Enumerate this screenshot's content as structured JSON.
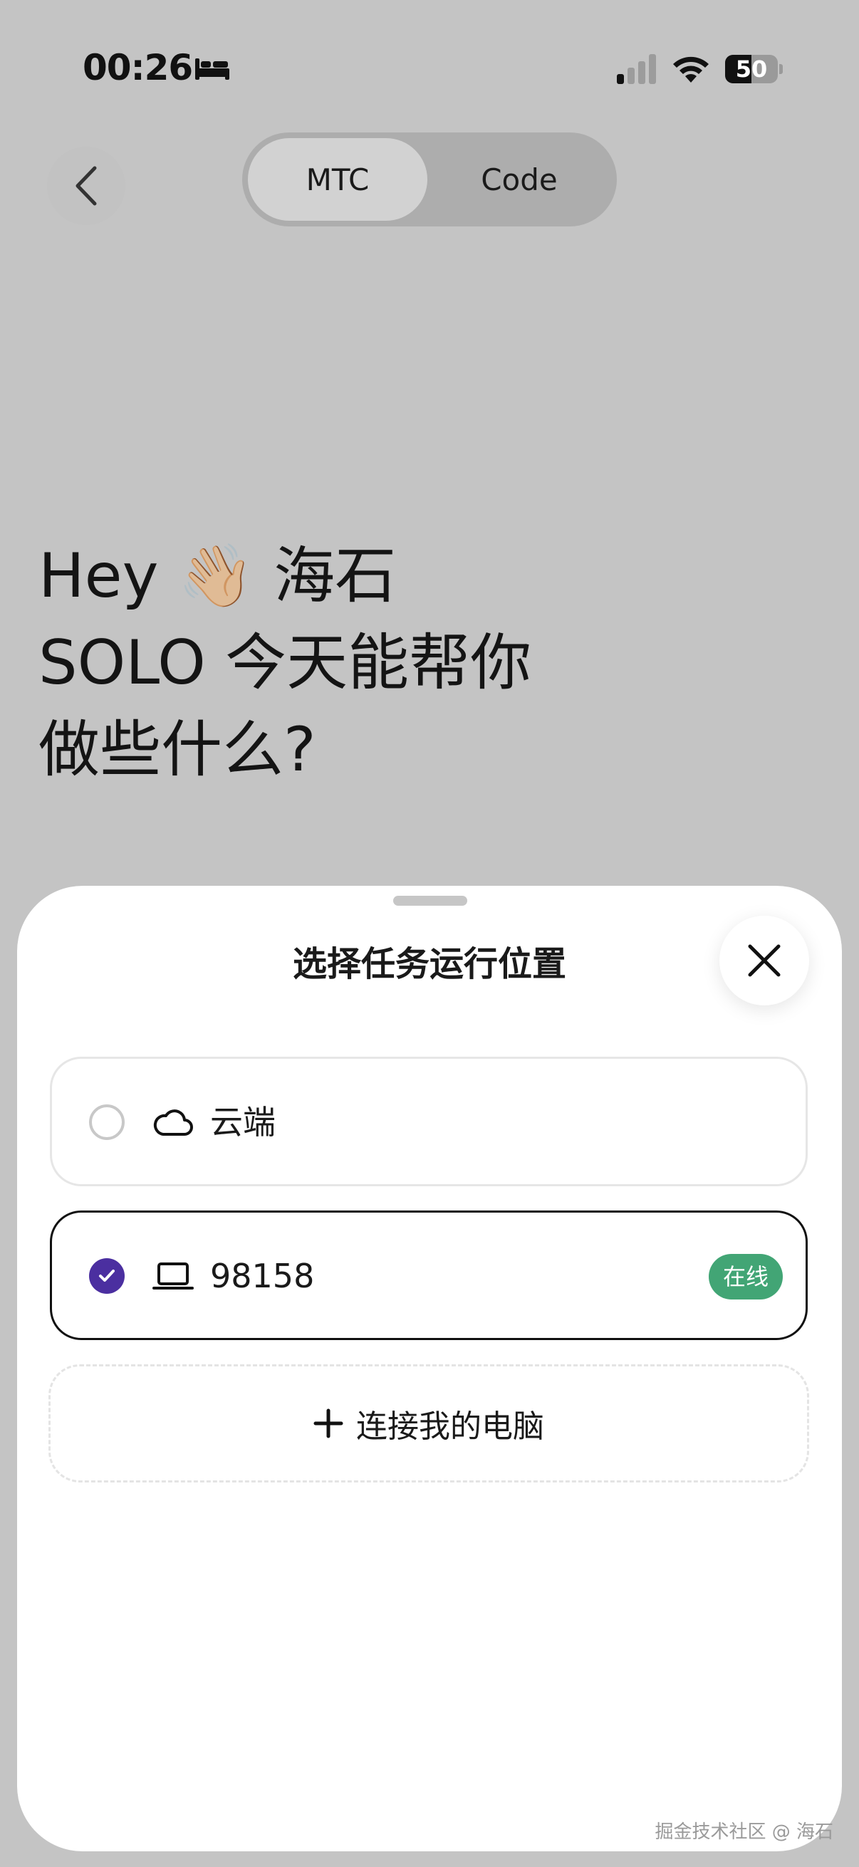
{
  "status_bar": {
    "time": "00:26",
    "battery_level": "50",
    "battery_fraction": 0.5,
    "icons": [
      "bed-icon",
      "signal-icon",
      "wifi-icon",
      "battery-icon"
    ]
  },
  "nav": {
    "back_icon": "chevron-left-icon",
    "tabs": [
      {
        "label": "MTC",
        "selected": true
      },
      {
        "label": "Code",
        "selected": false
      }
    ]
  },
  "greeting": {
    "line1": "Hey 👋🏼 海石",
    "line2": "SOLO 今天能帮你",
    "line3": "做些什么?"
  },
  "sheet": {
    "title": "选择任务运行位置",
    "close_icon": "close-icon",
    "options": [
      {
        "label": "云端",
        "icon": "cloud-icon",
        "selected": false
      },
      {
        "label": "98158",
        "icon": "laptop-icon",
        "selected": true,
        "badge": "在线"
      }
    ],
    "connect_label": "连接我的电脑",
    "connect_icon": "plus-icon"
  },
  "colors": {
    "accent": "#4b2fa0",
    "online": "#42a575",
    "overlay": "#c4c4c4"
  },
  "watermark": "掘金技术社区 @ 海石"
}
